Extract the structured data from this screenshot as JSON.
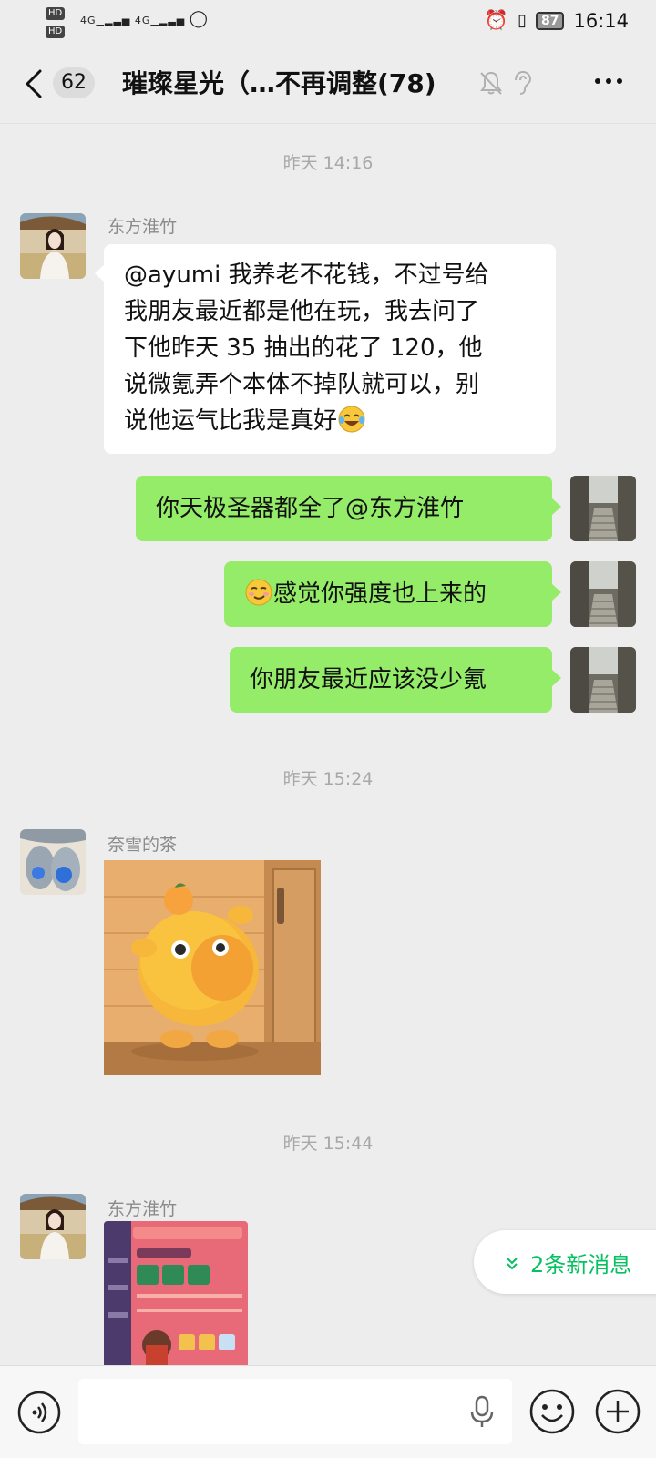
{
  "status_bar": {
    "hd1": "HD",
    "hd2": "HD",
    "network1": "4G",
    "network2": "4G",
    "battery": "87",
    "time": "16:14"
  },
  "header": {
    "unread_count": "62",
    "title": "璀璨星光（…不再调整(78)"
  },
  "messages": [
    {
      "type": "time",
      "text": "昨天 14:16"
    },
    {
      "type": "text",
      "side": "left",
      "sender": "东方淮竹",
      "lines": [
        "@ayumi  我养老不花钱，不过号给",
        "我朋友最近都是他在玩，我去问了",
        "下他昨天 35 抽出的花了 120，他",
        "说微氪弄个本体不掉队就可以，别",
        "说他运气比我是真好"
      ],
      "trailing_emoji": "laughing-tears-emoji"
    },
    {
      "type": "text",
      "side": "right",
      "text": "你天极圣器都全了@东方淮竹"
    },
    {
      "type": "text",
      "side": "right",
      "leading_emoji": "smirk-emoji",
      "text": "感觉你强度也上来的"
    },
    {
      "type": "text",
      "side": "right",
      "text": "你朋友最近应该没少氪"
    },
    {
      "type": "time",
      "text": "昨天 15:24"
    },
    {
      "type": "sticker",
      "side": "left",
      "sender": "奈雪的茶"
    },
    {
      "type": "time",
      "text": "昨天 15:44"
    },
    {
      "type": "image",
      "side": "left",
      "sender": "东方淮竹"
    }
  ],
  "new_messages": {
    "label": "2条新消息"
  },
  "input": {
    "placeholder": ""
  },
  "colors": {
    "bubble_self": "#95ec69",
    "bubble_other": "#ffffff",
    "accent": "#07c160",
    "background": "#ededed"
  }
}
